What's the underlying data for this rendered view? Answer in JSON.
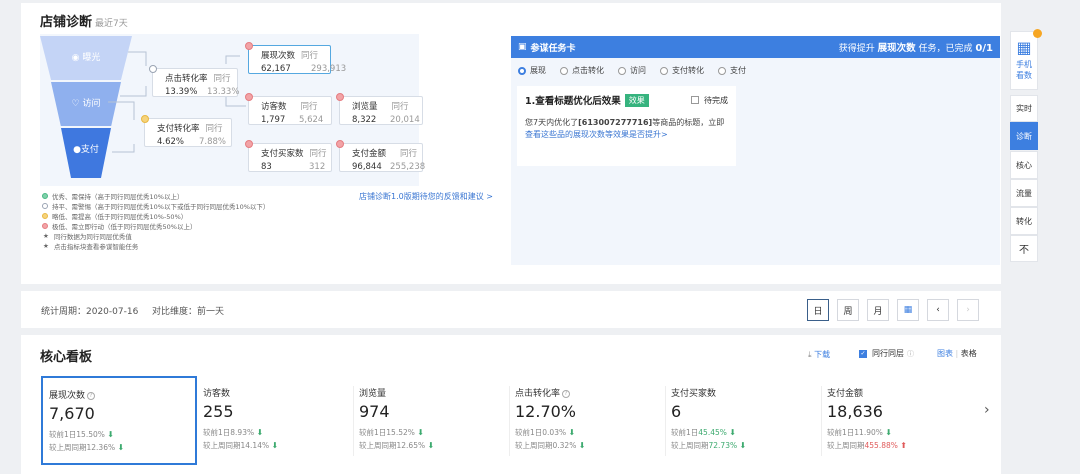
{
  "diagnosis": {
    "title": "店铺诊断",
    "subtitle": "最近7天",
    "funnel": [
      {
        "label": "曝光",
        "icon": "eye-icon"
      },
      {
        "label": "访问",
        "icon": "heart-icon"
      },
      {
        "label": "支付",
        "icon": "cart-icon"
      }
    ],
    "metrics": {
      "impressions": {
        "label": "展现次数",
        "peer_label": "同行",
        "value": "62,167",
        "peer": "293,913"
      },
      "click_rate": {
        "label": "点击转化率",
        "peer_label": "同行",
        "value": "13.39%",
        "peer": "13.33%"
      },
      "visitors": {
        "label": "访客数",
        "peer_label": "同行",
        "value": "1,797",
        "peer": "5,624"
      },
      "pageviews": {
        "label": "浏览量",
        "peer_label": "同行",
        "value": "8,322",
        "peer": "20,014"
      },
      "pay_rate": {
        "label": "支付转化率",
        "peer_label": "同行",
        "value": "4.62%",
        "peer": "7.88%"
      },
      "buyers": {
        "label": "支付买家数",
        "peer_label": "同行",
        "value": "83",
        "peer": "312"
      },
      "amount": {
        "label": "支付金额",
        "peer_label": "同行",
        "value": "96,844",
        "peer": "255,238"
      }
    },
    "legend": [
      "优秀、需保持（高于同行同层优秀10%以上）",
      "持平、需警惕（高于同行同层优秀10%以下或低于同行同层优秀10%以下）",
      "略低、需提高（低于同行同层优秀10%-50%）",
      "极低、需立即行动（低于同行同层优秀50%以上）",
      "同行数据为同行同层优秀值",
      "点击指标块查看参谋智能任务"
    ],
    "feedback_link": "店铺诊断1.0版期待您的反馈和建议 >"
  },
  "task_card": {
    "title": "参谋任务卡",
    "progress_prefix": "获得提升",
    "progress_metric": "展现次数",
    "progress_mid": "任务，已完成",
    "progress_count": "0/1",
    "options": [
      "展现",
      "点击转化",
      "访问",
      "支付转化",
      "支付"
    ],
    "task_title": "1.查看标题优化后效果",
    "badge": "效果",
    "pending": "待完成",
    "desc_prefix": "您7天内优化了",
    "desc_item": "[613007277716]",
    "desc_suffix": "等商品的标题，立即",
    "desc_link1": "查",
    "desc_link2": "看这些品的展现次数等效果是否提升>"
  },
  "rail": {
    "qr_label1": "手机",
    "qr_label2": "看数",
    "items": [
      "实时",
      "诊断",
      "核心",
      "流量",
      "转化",
      "不"
    ]
  },
  "period": {
    "stat_label": "统计周期：2020-07-16",
    "compare_label": "对比维度：前一天",
    "buttons": [
      "日",
      "周",
      "月"
    ]
  },
  "core": {
    "title": "核心看板",
    "download": "下载",
    "peer_layer": "同行同层",
    "chart_view": "图表",
    "table_view": "表格",
    "kpis": [
      {
        "label": "展现次数",
        "value": "7,670",
        "c1": "较前1日15.50%",
        "c2": "较上周同期12.36%",
        "has_q": true
      },
      {
        "label": "访客数",
        "value": "255",
        "c1": "较前1日8.93%",
        "c2": "较上周同期14.14%",
        "has_q": false
      },
      {
        "label": "浏览量",
        "value": "974",
        "c1": "较前1日15.52%",
        "c2": "较上周同期12.65%",
        "has_q": false
      },
      {
        "label": "点击转化率",
        "value": "12.70%",
        "c1": "较前1日0.03%",
        "c2": "较上周同期0.32%",
        "has_q": true
      },
      {
        "label": "支付买家数",
        "value": "6",
        "c1a": "较前1日",
        "c1b": "45.45%",
        "c2a": "较上周同期",
        "c2b": "72.73%",
        "has_q": false
      },
      {
        "label": "支付金额",
        "value": "18,636",
        "c1": "较前1日11.90%",
        "c2a": "较上周同期",
        "c2b": "455.88%",
        "has_q": false
      }
    ]
  }
}
